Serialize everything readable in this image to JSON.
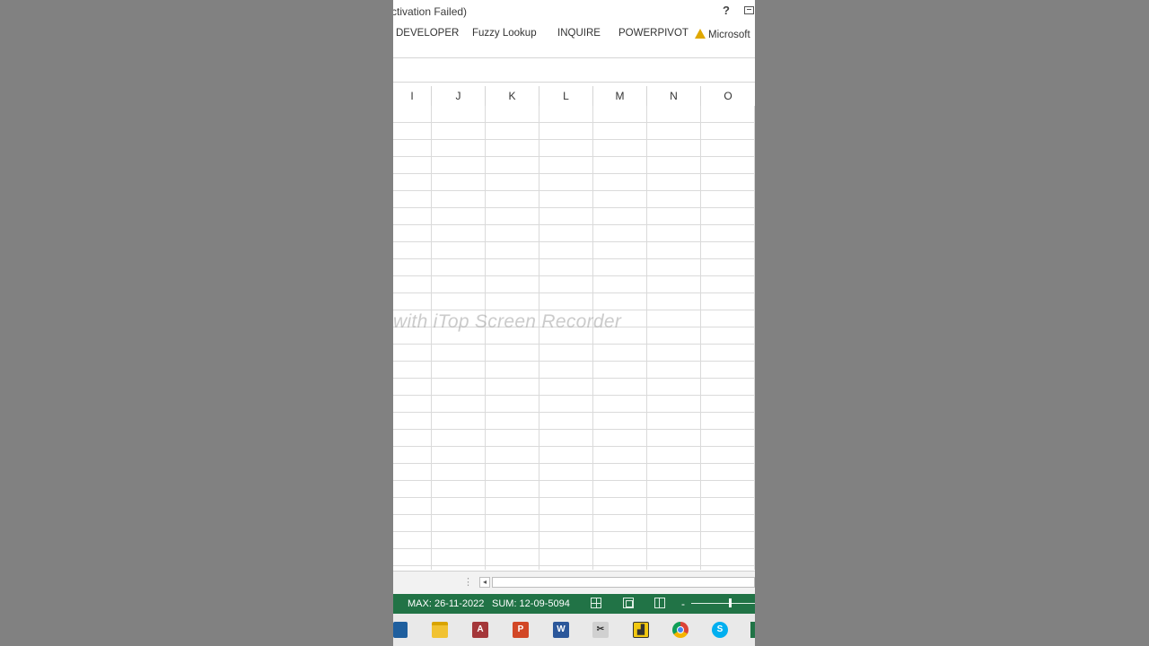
{
  "window": {
    "title": "ctivation Failed)",
    "help_label": "?"
  },
  "ribbon": {
    "tabs": [
      {
        "label": "DEVELOPER"
      },
      {
        "label": "Fuzzy Lookup"
      },
      {
        "label": "INQUIRE"
      },
      {
        "label": "POWERPIVOT"
      },
      {
        "label": "Microsoft"
      }
    ]
  },
  "columns": [
    "I",
    "J",
    "K",
    "L",
    "M",
    "N",
    "O"
  ],
  "watermark": "with iTop Screen Recorder",
  "sheetbar": {
    "scroll_left": "◂"
  },
  "statusbar": {
    "max": "MAX: 26-11-2022",
    "sum": "SUM: 12-09-5094",
    "zoom_minus": "-"
  },
  "taskbar": {
    "apps": [
      "store-icon",
      "file-explorer-icon",
      "access-icon",
      "powerpoint-icon",
      "word-icon",
      "tools-icon",
      "power-bi-icon",
      "chrome-icon",
      "skype-icon",
      "excel-icon"
    ],
    "access_letter": "A",
    "ppt_letter": "P",
    "word_letter": "W",
    "skype_letter": "S"
  },
  "colors": {
    "status_green": "#217346",
    "background_gray": "#818181"
  }
}
